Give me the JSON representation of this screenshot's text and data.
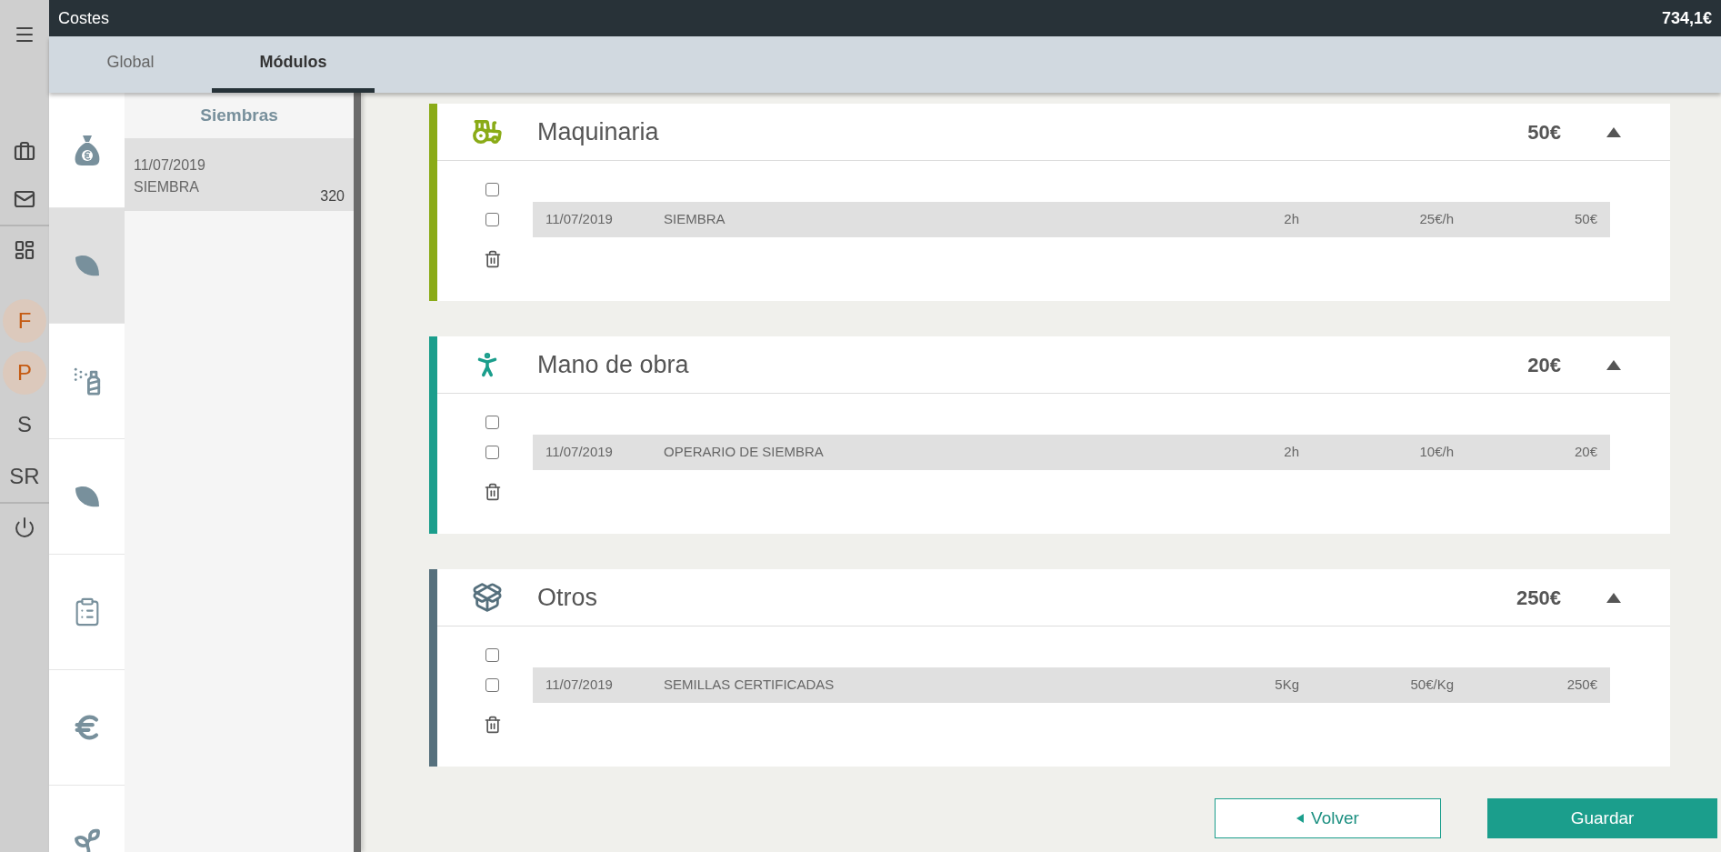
{
  "header": {
    "title": "Costes",
    "total": "734,1€"
  },
  "tabs": [
    {
      "label": "Global",
      "selected": false
    },
    {
      "label": "Módulos",
      "selected": true
    }
  ],
  "rail": {
    "top": [
      {
        "kind": "menu"
      }
    ],
    "apps": [
      {
        "kind": "briefcase"
      },
      {
        "kind": "mail"
      }
    ],
    "tools": [
      {
        "kind": "dashboard"
      }
    ],
    "letters": [
      {
        "label": "F",
        "highlighted": true
      },
      {
        "label": "P",
        "highlighted": true
      },
      {
        "label": "S",
        "highlighted": false
      },
      {
        "label": "SR",
        "highlighted": false
      }
    ],
    "bottom": [
      {
        "kind": "power"
      }
    ]
  },
  "modules": [
    {
      "kind": "money-bag",
      "selected": false
    },
    {
      "kind": "leaf",
      "selected": true
    },
    {
      "kind": "spray",
      "selected": false
    },
    {
      "kind": "leaf",
      "selected": false
    },
    {
      "kind": "clipboard",
      "selected": false
    },
    {
      "kind": "euro",
      "selected": false
    },
    {
      "kind": "plant",
      "selected": false
    }
  ],
  "list": {
    "title": "Siembras",
    "items": [
      {
        "date": "11/07/2019",
        "name": "SIEMBRA",
        "value": "320",
        "selected": true
      }
    ]
  },
  "cards": [
    {
      "kind": "tractor",
      "title": "Maquinaria",
      "total": "50€",
      "color": "#8aab17",
      "expanded": true,
      "select_all": false,
      "rows": [
        {
          "checked": false,
          "date": "11/07/2019",
          "concept": "SIEMBRA",
          "quantity": "2h",
          "price": "25€/h",
          "amount": "50€"
        }
      ]
    },
    {
      "kind": "worker",
      "title": "Mano de obra",
      "total": "20€",
      "color": "#1b9e8c",
      "expanded": true,
      "select_all": false,
      "rows": [
        {
          "checked": false,
          "date": "11/07/2019",
          "concept": "OPERARIO DE SIEMBRA",
          "quantity": "2h",
          "price": "10€/h",
          "amount": "20€"
        }
      ]
    },
    {
      "kind": "box",
      "title": "Otros",
      "total": "250€",
      "color": "#56707d",
      "expanded": true,
      "select_all": false,
      "rows": [
        {
          "checked": false,
          "date": "11/07/2019",
          "concept": "SEMILLAS CERTIFICADAS",
          "quantity": "5Kg",
          "price": "50€/Kg",
          "amount": "250€"
        }
      ]
    }
  ],
  "buttons": {
    "back": "Volver",
    "save": "Guardar"
  }
}
